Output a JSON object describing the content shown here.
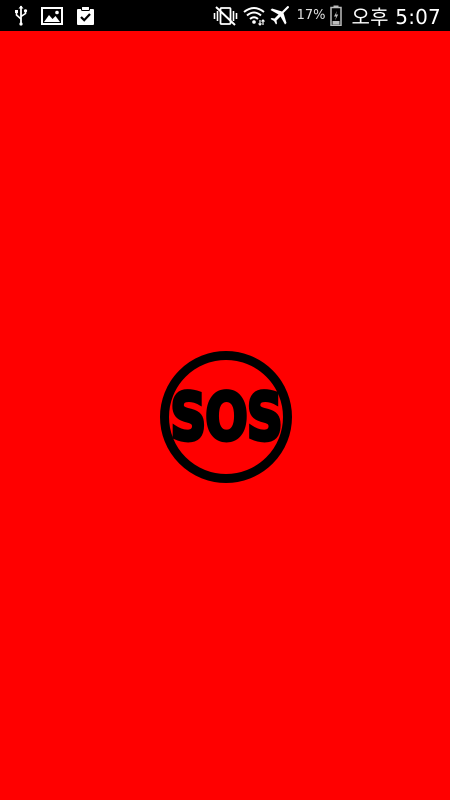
{
  "status_bar": {
    "left_icons": [
      "usb-icon",
      "image-icon",
      "clipboard-check-icon"
    ],
    "right_icons": [
      "vibrate-icon",
      "wifi-icon",
      "airplane-mode-icon",
      "battery-icon"
    ],
    "battery_percent": "17%",
    "time": "오후 5:07",
    "background": "#000000"
  },
  "sos_logo": {
    "text": "SOS",
    "color": "#000000"
  },
  "theme": {
    "background": "#ff0000"
  }
}
